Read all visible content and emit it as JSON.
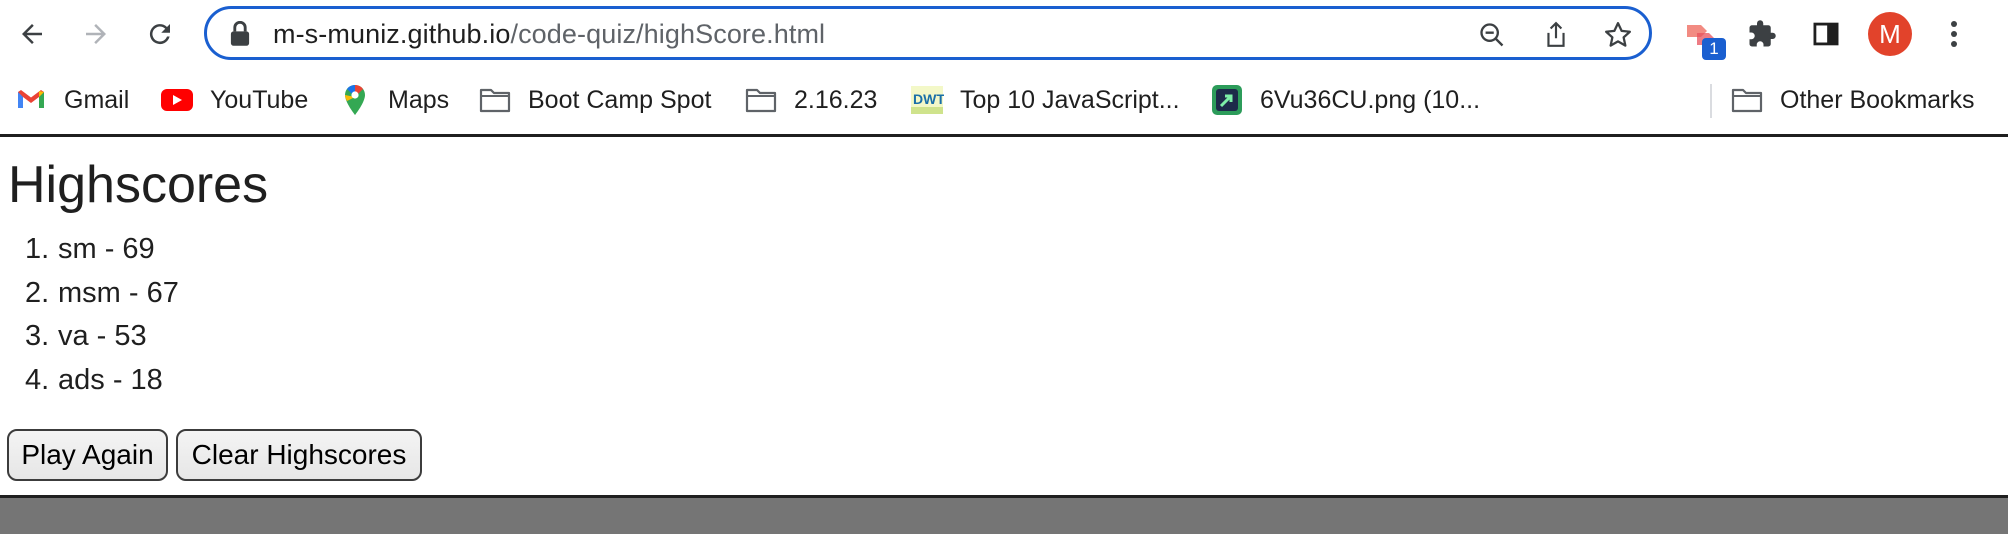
{
  "browser": {
    "url_host": "m-s-muniz.github.io",
    "url_path": "/code-quiz/highScore.html",
    "extension_badge": "1",
    "profile_initial": "M",
    "icons": {
      "back": "back-arrow-icon",
      "forward": "forward-arrow-icon",
      "reload": "reload-icon",
      "lock": "lock-icon",
      "zoom": "zoom-out-icon",
      "share": "share-icon",
      "star": "bookmark-star-icon",
      "extension": "extension-icon",
      "puzzle": "puzzle-icon",
      "sidepanel": "side-panel-icon",
      "menu": "kebab-menu-icon"
    },
    "colors": {
      "focus_ring": "#1a5fd0",
      "avatar": "#e2432b"
    }
  },
  "bookmarks": {
    "items": [
      {
        "label": "Gmail",
        "icon": "gmail-icon"
      },
      {
        "label": "YouTube",
        "icon": "youtube-icon"
      },
      {
        "label": "Maps",
        "icon": "maps-icon"
      },
      {
        "label": "Boot Camp Spot",
        "icon": "folder-icon"
      },
      {
        "label": "2.16.23",
        "icon": "folder-icon"
      },
      {
        "label": "Top 10 JavaScript...",
        "icon": "dwt-icon"
      },
      {
        "label": "6Vu36CU.png (10...",
        "icon": "image-icon"
      }
    ],
    "other": {
      "label": "Other Bookmarks",
      "icon": "folder-icon"
    }
  },
  "page": {
    "title": "Highscores",
    "scores": [
      {
        "num": "1.",
        "text": "sm - 69"
      },
      {
        "num": "2.",
        "text": "msm - 67"
      },
      {
        "num": "3.",
        "text": "va - 53"
      },
      {
        "num": "4.",
        "text": "ads - 18"
      }
    ],
    "buttons": {
      "play_again": "Play Again",
      "clear": "Clear Highscores"
    }
  }
}
